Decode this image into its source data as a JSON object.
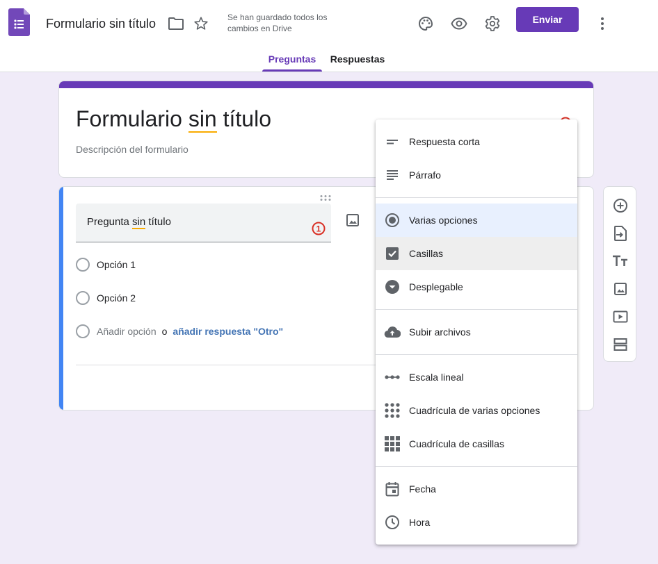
{
  "header": {
    "doc_title": "Formulario sin título",
    "save_status": "Se han guardado todos los cambios en Drive",
    "send_label": "Enviar",
    "tabs": [
      {
        "label": "Preguntas",
        "active": true
      },
      {
        "label": "Respuestas",
        "active": false
      }
    ]
  },
  "form": {
    "title_before": "Formulario ",
    "title_spell": "sin",
    "title_after": " título",
    "description_placeholder": "Descripción del formulario"
  },
  "question": {
    "title_before": "Pregunta ",
    "title_spell": "sin",
    "title_after": " título",
    "error_count": "1",
    "options": [
      "Opción 1",
      "Opción 2"
    ],
    "add_option": "Añadir opción",
    "or_text": "o",
    "add_other": "añadir respuesta \"Otro\""
  },
  "type_menu": {
    "items": [
      {
        "label": "Respuesta corta",
        "icon": "short-answer-icon"
      },
      {
        "label": "Párrafo",
        "icon": "paragraph-icon"
      },
      {
        "label": "Varias opciones",
        "icon": "radio-button-icon",
        "state": "selected"
      },
      {
        "label": "Casillas",
        "icon": "checkbox-icon",
        "state": "hovered"
      },
      {
        "label": "Desplegable",
        "icon": "dropdown-icon"
      },
      {
        "label": "Subir archivos",
        "icon": "cloud-upload-icon"
      },
      {
        "label": "Escala lineal",
        "icon": "linear-scale-icon"
      },
      {
        "label": "Cuadrícula de varias opciones",
        "icon": "dot-grid-icon"
      },
      {
        "label": "Cuadrícula de casillas",
        "icon": "checkbox-grid-icon"
      },
      {
        "label": "Fecha",
        "icon": "calendar-icon"
      },
      {
        "label": "Hora",
        "icon": "clock-icon"
      }
    ]
  },
  "side_toolbar": [
    "add-question-icon",
    "import-questions-icon",
    "add-title-icon",
    "add-image-icon",
    "add-video-icon",
    "add-section-icon"
  ],
  "colors": {
    "brand": "#673ab7",
    "active_card": "#4285f4",
    "background": "#f0ebf8",
    "selected_item": "#e8f0fe",
    "error": "#d93025",
    "link": "#4374b4"
  }
}
